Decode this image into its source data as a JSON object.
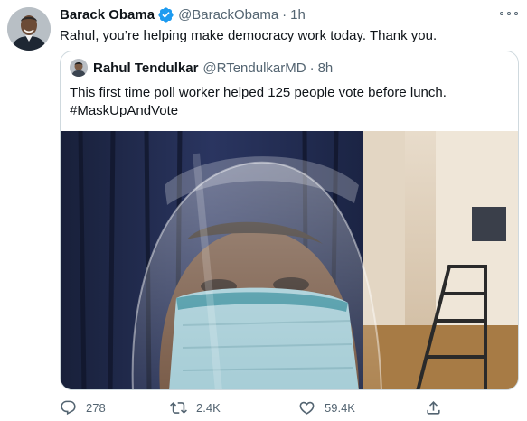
{
  "tweet": {
    "author_name": "Barack Obama",
    "author_handle": "@BarackObama",
    "separator": "·",
    "time": "1h",
    "text": "Rahul, you’re helping make democracy work today. Thank you."
  },
  "quoted_tweet": {
    "author_name": "Rahul Tendulkar",
    "author_handle": "@RTendulkarMD",
    "separator": "·",
    "time": "8h",
    "text_line1": "This first time poll worker helped 125 people vote before lunch.",
    "text_line2": "#MaskUpAndVote"
  },
  "actions": {
    "replies": "278",
    "retweets": "2.4K",
    "likes": "59.4K"
  },
  "icons": {
    "verified": "verified-badge-icon",
    "more": "more-options-icon",
    "reply": "reply-icon",
    "retweet": "retweet-icon",
    "like": "heart-icon",
    "share": "share-icon"
  },
  "colors": {
    "verified": "#1d9bf0",
    "text": "#0f1419",
    "muted": "#536471",
    "border": "#cfd9de"
  }
}
